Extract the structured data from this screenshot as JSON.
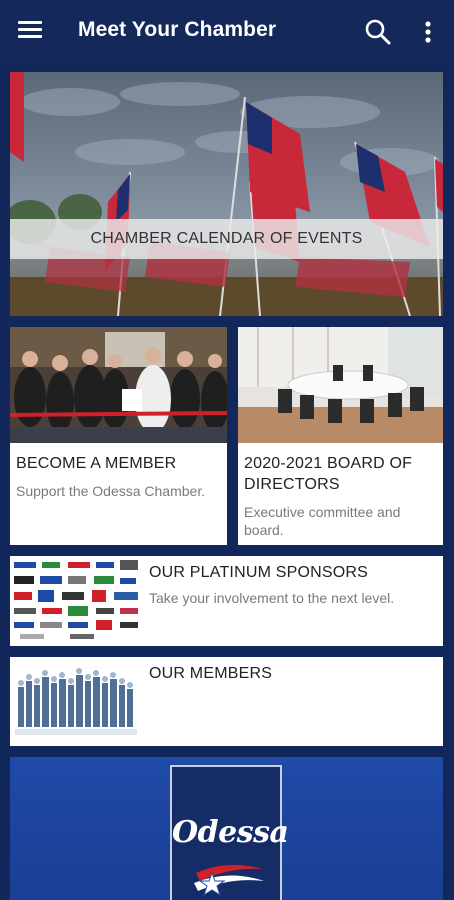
{
  "app_bar": {
    "title": "Meet Your Chamber"
  },
  "hero": {
    "label": "CHAMBER CALENDAR OF EVENTS"
  },
  "member_card": {
    "title": "BECOME A MEMBER",
    "subtitle": "Support the Odessa Chamber."
  },
  "board_card": {
    "title": "2020-2021 BOARD OF DIRECTORS",
    "subtitle": "Executive committee and board."
  },
  "sponsor_card": {
    "title": "OUR PLATINUM SPONSORS",
    "subtitle": "Take your involvement to the next level."
  },
  "members_list_card": {
    "title": "OUR MEMBERS"
  },
  "banner": {
    "logo_text": "Odessa"
  },
  "colors": {
    "app_bar": "#14285a",
    "background": "#12285a",
    "banner": "#1f4aa8"
  },
  "icons": [
    "menu-icon",
    "search-icon",
    "more-vert-icon"
  ]
}
